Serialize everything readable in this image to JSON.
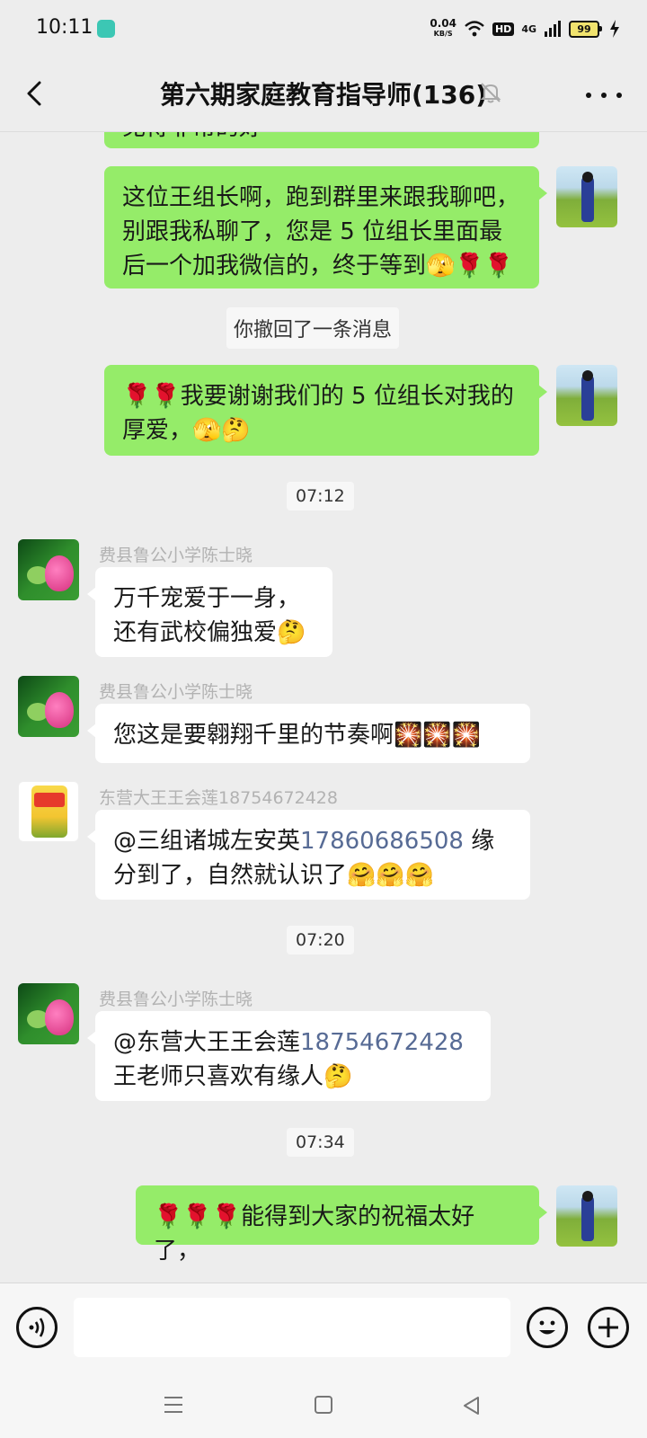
{
  "status_bar": {
    "time": "10:11",
    "net_speed_value": "0.04",
    "net_speed_unit": "KB/S",
    "hd_label": "HD",
    "network_label": "4G",
    "battery": "99"
  },
  "header": {
    "title": "第六期家庭教育指导师(136)"
  },
  "messages": {
    "out_partial": "免得非常的好",
    "out1": "这位王组长啊，跑到群里来跟我聊吧，别跟我私聊了，您是 5 位组长里面最后一个加我微信的，终于等到🫣🌹🌹",
    "recall_notice": "你撤回了一条消息",
    "out2": "🌹🌹我要谢谢我们的 5 位组长对我的厚爱，🫣🤔",
    "time1": "07:12",
    "in1_sender": "费县鲁公小学陈士晓",
    "in1_text": "万千宠爱于一身，还有武校偏独爱🤔",
    "in2_sender": "费县鲁公小学陈士晓",
    "in2_text": "您这是要翱翔千里的节奏啊🎇🎇🎇",
    "in3_sender": "东营大王王会莲18754672428",
    "in3_mention": "@三组诸城左安英",
    "in3_phone": "17860686508",
    "in3_text": " 缘分到了，自然就认识了🤗🤗🤗",
    "time2": "07:20",
    "in4_sender": "费县鲁公小学陈士晓",
    "in4_mention": "@东营大王王会莲",
    "in4_phone": "18754672428",
    "in4_text": "王老师只喜欢有缘人🤔",
    "time3": "07:34",
    "out3": "🌹🌹🌹能得到大家的祝福太好了，"
  },
  "colors": {
    "outgoing_bubble": "#95ec69",
    "incoming_bubble": "#ffffff",
    "background": "#ededed",
    "link": "#576b95"
  },
  "icons": {
    "back": "chevron-left-icon",
    "mute": "bell-off-icon",
    "more": "more-dots-icon",
    "voice": "voice-icon",
    "emoji": "emoji-icon",
    "plus": "plus-icon"
  }
}
